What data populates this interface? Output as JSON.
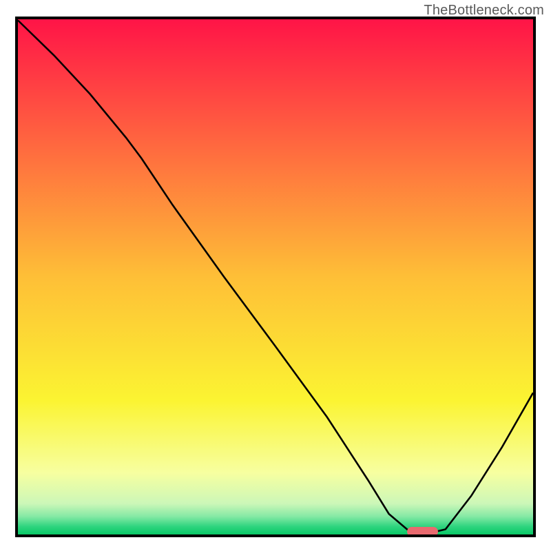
{
  "watermark": "TheBottleneck.com",
  "chart_data": {
    "type": "line",
    "title": "",
    "xlabel": "",
    "ylabel": "",
    "xlim": [
      0,
      100
    ],
    "ylim": [
      0,
      100
    ],
    "grid": false,
    "background_gradient": {
      "orientation": "vertical",
      "stops": [
        {
          "offset": 0.0,
          "color": "#ff1447"
        },
        {
          "offset": 0.25,
          "color": "#ff6a3f"
        },
        {
          "offset": 0.5,
          "color": "#febf37"
        },
        {
          "offset": 0.74,
          "color": "#fbf432"
        },
        {
          "offset": 0.88,
          "color": "#f7ffa0"
        },
        {
          "offset": 0.94,
          "color": "#ccf7b8"
        },
        {
          "offset": 0.965,
          "color": "#85e9a5"
        },
        {
          "offset": 0.985,
          "color": "#2dd47e"
        },
        {
          "offset": 1.0,
          "color": "#08c866"
        }
      ]
    },
    "series": [
      {
        "name": "bottleneck-curve",
        "color": "#000000",
        "x": [
          0.0,
          7.0,
          14.0,
          21.0,
          24.0,
          30.0,
          40.0,
          50.0,
          60.0,
          68.0,
          72.0,
          76.0,
          80.0,
          83.0,
          88.0,
          94.0,
          100.0
        ],
        "values": [
          99.8,
          93.0,
          85.5,
          77.0,
          73.0,
          64.0,
          50.0,
          36.5,
          22.8,
          10.5,
          4.0,
          0.6,
          0.3,
          1.0,
          7.5,
          17.0,
          27.5
        ]
      }
    ],
    "marker": {
      "name": "optimal-range",
      "color": "#e96a6f",
      "x_start": 75.5,
      "x_end": 81.5,
      "y": 0.5,
      "shape": "rounded-bar"
    }
  }
}
